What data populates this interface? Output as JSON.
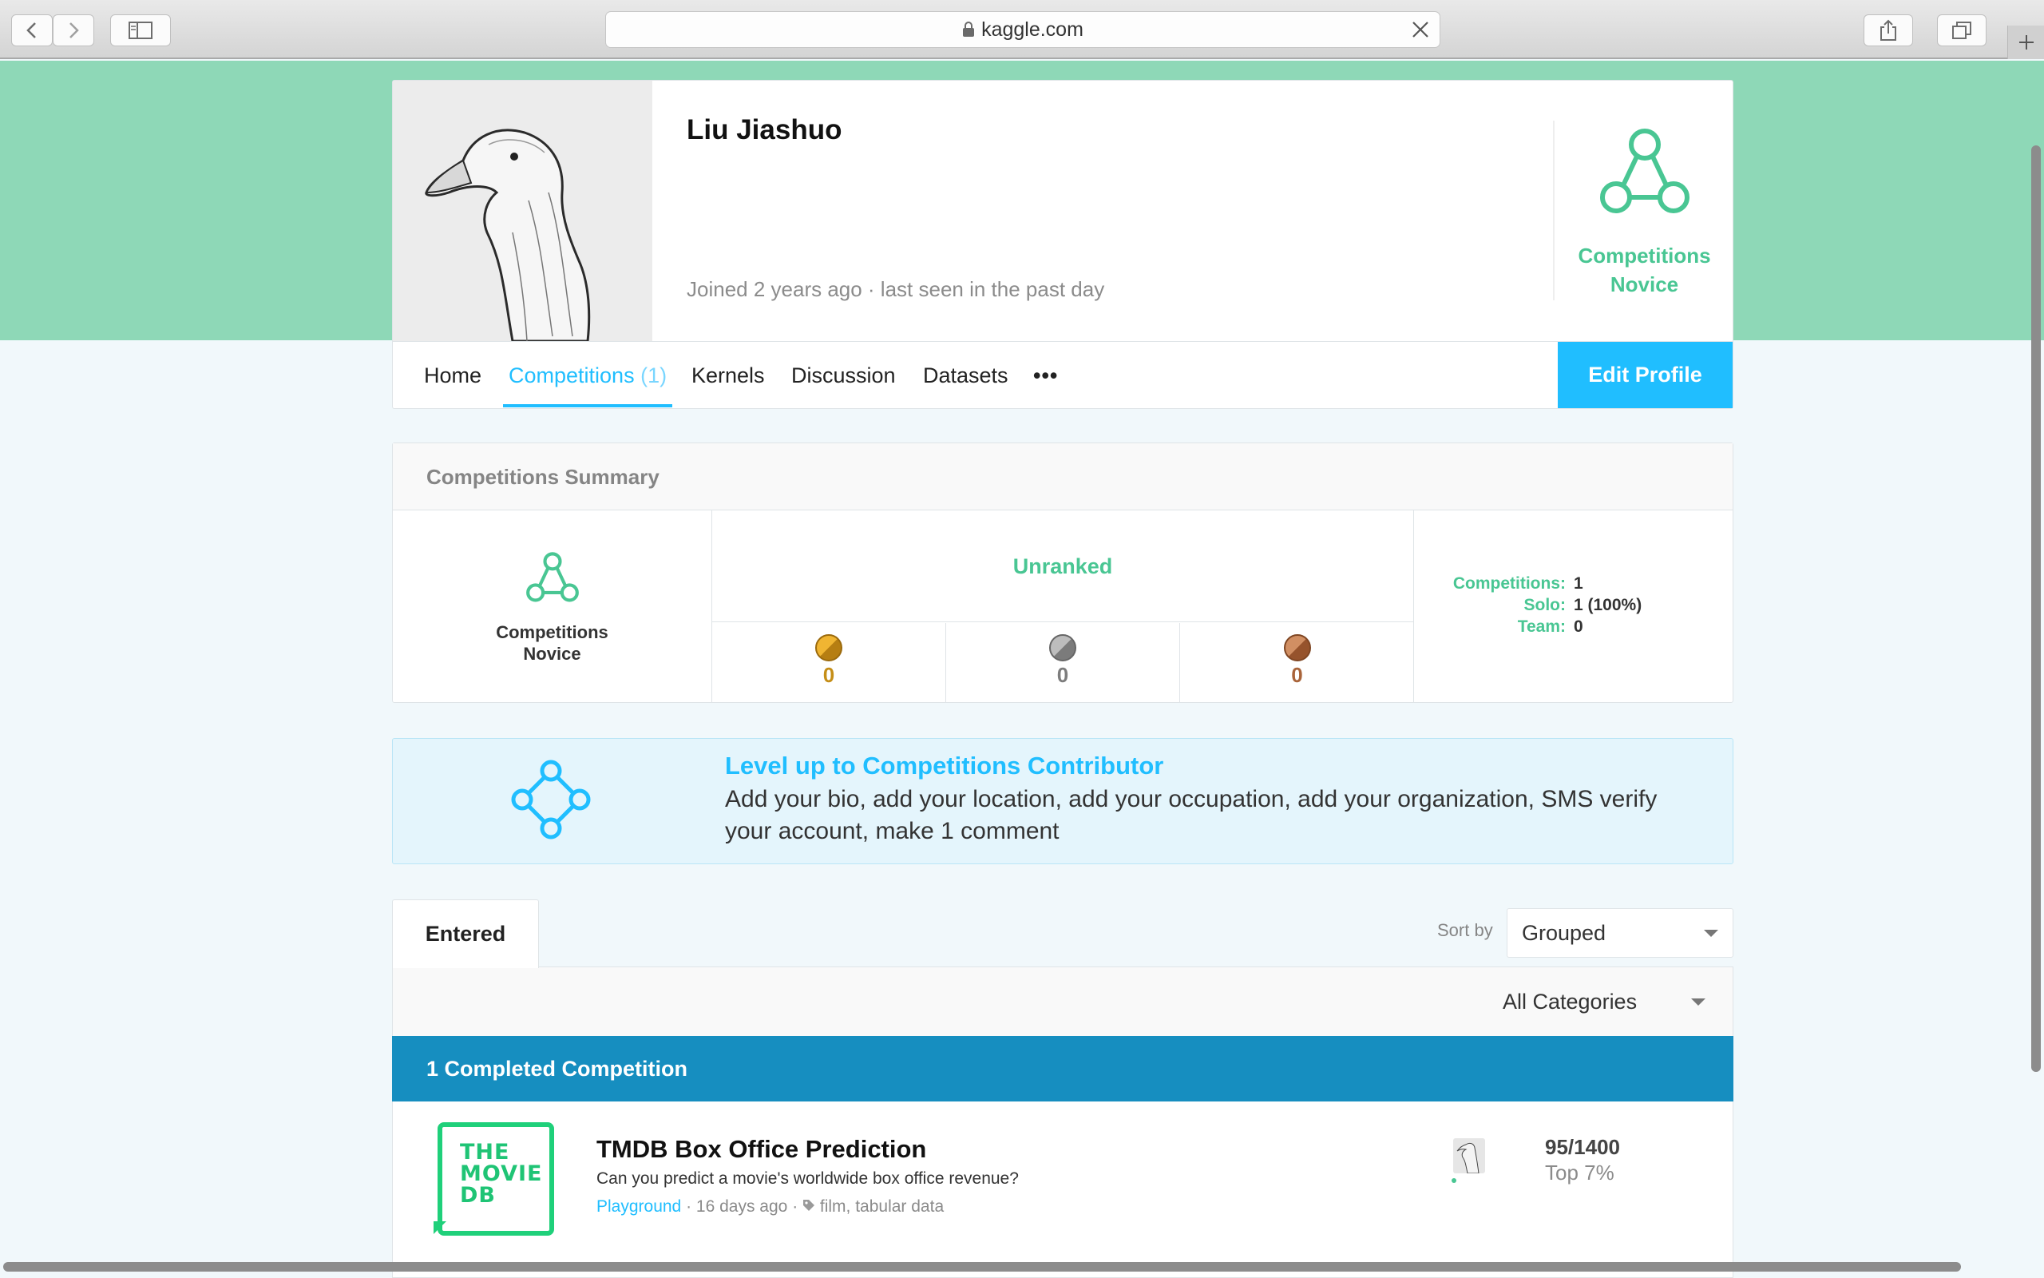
{
  "browser": {
    "url": "kaggle.com",
    "icons": [
      "back-icon",
      "forward-icon",
      "sidebar-icon",
      "lock-icon",
      "clear-icon",
      "share-icon",
      "tabs-icon",
      "new-tab-icon"
    ]
  },
  "profile": {
    "name": "Liu Jiashuo",
    "joined": "Joined 2 years ago · last seen in the past day",
    "tier_line1": "Competitions",
    "tier_line2": "Novice"
  },
  "nav": {
    "items": [
      {
        "label": "Home"
      },
      {
        "label": "Competitions",
        "count": "(1)"
      },
      {
        "label": "Kernels"
      },
      {
        "label": "Discussion"
      },
      {
        "label": "Datasets"
      },
      {
        "label": "•••"
      }
    ],
    "edit_label": "Edit Profile"
  },
  "summary": {
    "title": "Competitions Summary",
    "tier_line1": "Competitions",
    "tier_line2": "Novice",
    "rank": "Unranked",
    "medals": [
      {
        "type": "gold",
        "count": "0",
        "color": "#d39817"
      },
      {
        "type": "silver",
        "count": "0",
        "color": "#7d7d7d"
      },
      {
        "type": "bronze",
        "count": "0",
        "color": "#b0673c"
      }
    ],
    "stats": [
      {
        "key": "Competitions:",
        "value": "1"
      },
      {
        "key": "Solo:",
        "value": "1 (100%)"
      },
      {
        "key": "Team:",
        "value": "0"
      }
    ]
  },
  "levelup": {
    "title": "Level up to Competitions Contributor",
    "text": "Add your bio, add your location, add your occupation, add your organization, SMS verify your account, make 1 comment"
  },
  "list": {
    "tab": "Entered",
    "sort_label": "Sort by",
    "sort_value": "Grouped",
    "filter_value": "All Categories",
    "group_header": "1 Completed Competition",
    "competitions": [
      {
        "logo_lines": [
          "THE",
          "MOVIE",
          "DB"
        ],
        "title": "TMDB Box Office Prediction",
        "description": "Can you predict a movie's worldwide box office revenue?",
        "category": "Playground",
        "age": "16 days ago",
        "tags": "film, tabular data",
        "rank": "95/1400",
        "percentile": "Top 7%"
      }
    ]
  },
  "colors": {
    "accent": "#20beff",
    "tier_green": "#49c693",
    "hero": "#8ed8b7",
    "group_bar": "#168ec0"
  }
}
